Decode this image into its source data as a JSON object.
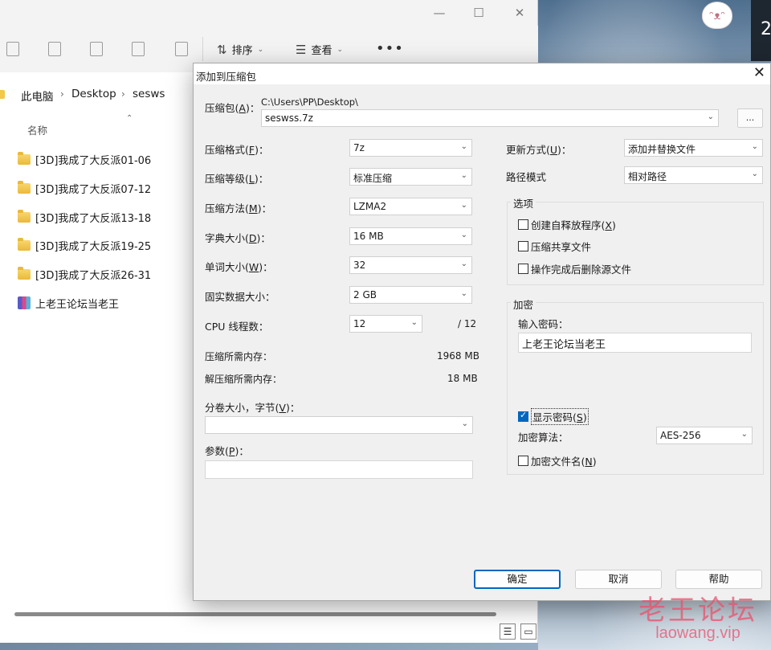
{
  "explorer": {
    "toolbar": {
      "sort_label": "排序",
      "view_label": "查看",
      "more_label": "•••"
    },
    "breadcrumb": [
      "此电脑",
      "Desktop",
      "sesws"
    ],
    "column_header": "名称",
    "items": [
      {
        "name": "[3D]我成了大反派01-06",
        "type": "folder"
      },
      {
        "name": "[3D]我成了大反派07-12",
        "type": "folder"
      },
      {
        "name": "[3D]我成了大反派13-18",
        "type": "folder"
      },
      {
        "name": "[3D]我成了大反派19-25",
        "type": "folder"
      },
      {
        "name": "[3D]我成了大反派26-31",
        "type": "folder"
      },
      {
        "name": "上老王论坛当老王",
        "type": "archive"
      }
    ]
  },
  "dialog": {
    "title": "添加到压缩包",
    "archive_label": "压缩包(",
    "archive_key": "A",
    "archive_path": "C:\\Users\\PP\\Desktop\\",
    "archive_name": "seswss.7z",
    "browse_label": "...",
    "left": [
      {
        "label": "压缩格式(",
        "key": "F",
        "value": "7z"
      },
      {
        "label": "压缩等级(",
        "key": "L",
        "value": "标准压缩"
      },
      {
        "label": "压缩方法(",
        "key": "M",
        "value": "LZMA2"
      },
      {
        "label": "字典大小(",
        "key": "D",
        "value": "16 MB"
      },
      {
        "label": "单词大小(",
        "key": "W",
        "value": "32"
      },
      {
        "label": "固实数据大小：",
        "key": "",
        "value": "2 GB"
      }
    ],
    "cpu_label": "CPU 线程数：",
    "cpu_value": "12",
    "cpu_max": "/ 12",
    "mem_compress_label": "压缩所需内存：",
    "mem_compress_value": "1968 MB",
    "mem_decompress_label": "解压缩所需内存：",
    "mem_decompress_value": "18 MB",
    "volume_label": "分卷大小，字节(",
    "volume_key": "V",
    "volume_value": "",
    "params_label": "参数(",
    "params_key": "P",
    "params_value": "",
    "update_label": "更新方式(",
    "update_key": "U",
    "update_value": "添加并替换文件",
    "pathmode_label": "路径模式",
    "pathmode_value": "相对路径",
    "options_title": "选项",
    "options": [
      {
        "label": "创建自释放程序(",
        "key": "X",
        "checked": false
      },
      {
        "label": "压缩共享文件",
        "key": "",
        "checked": false
      },
      {
        "label": "操作完成后删除源文件",
        "key": "",
        "checked": false
      }
    ],
    "encrypt_title": "加密",
    "password_label": "输入密码：",
    "password_value": "上老王论坛当老王",
    "show_password_label": "显示密码(",
    "show_password_key": "S",
    "show_password_checked": true,
    "enc_method_label": "加密算法：",
    "enc_method_value": "AES-256",
    "enc_filenames_label": "加密文件名(",
    "enc_filenames_key": "N",
    "enc_filenames_checked": false,
    "ok_label": "确定",
    "cancel_label": "取消",
    "help_label": "帮助"
  },
  "watermark": {
    "line1": "老王论坛",
    "line2": "laowang.vip"
  },
  "colors": {
    "accent": "#0067c0",
    "folder": "#f4c64b",
    "watermark": "#eb506e"
  }
}
